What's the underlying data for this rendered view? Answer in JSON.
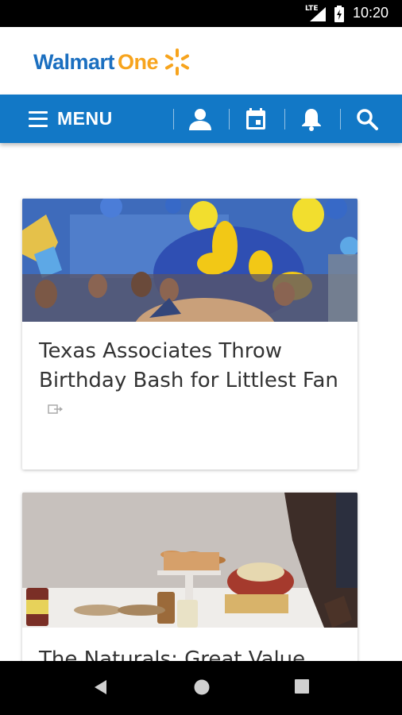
{
  "status_bar": {
    "network": "LTE",
    "time": "10:20"
  },
  "brand": {
    "word1": "Walmart",
    "word2": "One"
  },
  "navbar": {
    "menu_label": "MENU",
    "icons": [
      "profile-icon",
      "calendar-icon",
      "bell-icon",
      "search-icon"
    ]
  },
  "colors": {
    "nav_blue": "#1278c6",
    "brand_blue": "#1b6fc0",
    "brand_yellow": "#f7a41d"
  },
  "feed": {
    "cards": [
      {
        "title": "Texas Associates Throw Birthday Bash for Littlest Fan",
        "image": "birthday-party-photo"
      },
      {
        "title": "The Naturals: Great Value",
        "image": "great-value-products-photo"
      }
    ]
  }
}
